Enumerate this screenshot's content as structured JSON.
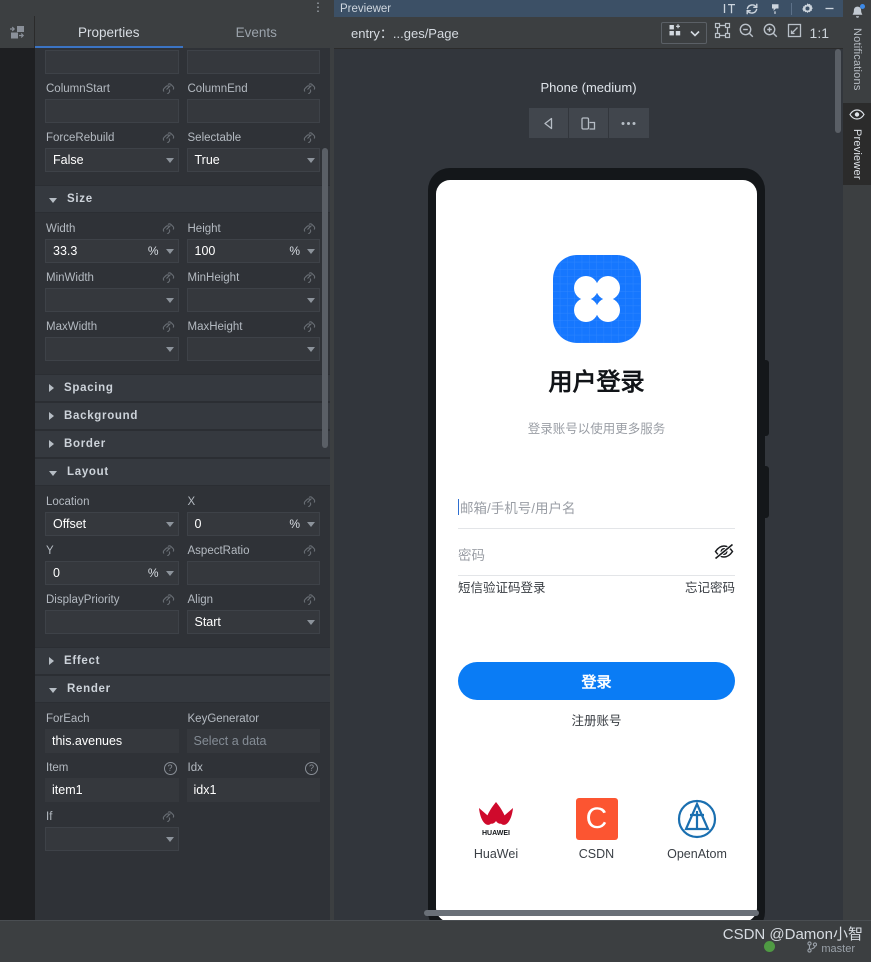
{
  "properties_panel": {
    "window_dots": "⋮",
    "panel_icon": "add-component-icon",
    "tabs": [
      {
        "label": "Properties",
        "active": true
      },
      {
        "label": "Events",
        "active": false
      }
    ],
    "sections": [
      {
        "name": "top-fields",
        "title": "",
        "expanded": true,
        "rows": [
          {
            "left": {
              "label": "",
              "value": "",
              "type": "text",
              "link": false
            },
            "right": {
              "label": "",
              "value": "",
              "type": "text",
              "link": false
            }
          },
          {
            "left": {
              "label": "ColumnStart",
              "value": "",
              "type": "text",
              "link": true
            },
            "right": {
              "label": "ColumnEnd",
              "value": "",
              "type": "text",
              "link": true
            }
          },
          {
            "left": {
              "label": "ForceRebuild",
              "value": "False",
              "type": "select",
              "link": true
            },
            "right": {
              "label": "Selectable",
              "value": "True",
              "type": "select",
              "link": true
            }
          }
        ]
      },
      {
        "name": "size",
        "title": "Size",
        "expanded": true,
        "rows": [
          {
            "left": {
              "label": "Width",
              "value": "33.3",
              "unit": "%",
              "type": "unit-select",
              "link": true
            },
            "right": {
              "label": "Height",
              "value": "100",
              "unit": "%",
              "type": "unit-select",
              "link": true
            }
          },
          {
            "left": {
              "label": "MinWidth",
              "value": "",
              "type": "select",
              "link": true
            },
            "right": {
              "label": "MinHeight",
              "value": "",
              "type": "select",
              "link": true
            }
          },
          {
            "left": {
              "label": "MaxWidth",
              "value": "",
              "type": "select",
              "link": true
            },
            "right": {
              "label": "MaxHeight",
              "value": "",
              "type": "select",
              "link": true
            }
          }
        ]
      },
      {
        "name": "spacing",
        "title": "Spacing",
        "expanded": false,
        "rows": []
      },
      {
        "name": "background",
        "title": "Background",
        "expanded": false,
        "rows": []
      },
      {
        "name": "border",
        "title": "Border",
        "expanded": false,
        "rows": []
      },
      {
        "name": "layout",
        "title": "Layout",
        "expanded": true,
        "rows": [
          {
            "left": {
              "label": "Location",
              "value": "Offset",
              "type": "select",
              "link": false
            },
            "right": {
              "label": "X",
              "value": "0",
              "unit": "%",
              "type": "unit-select",
              "link": true
            }
          },
          {
            "left": {
              "label": "Y",
              "value": "0",
              "unit": "%",
              "type": "unit-select",
              "link": true
            },
            "right": {
              "label": "AspectRatio",
              "value": "",
              "type": "text",
              "link": true
            }
          },
          {
            "left": {
              "label": "DisplayPriority",
              "value": "",
              "type": "text",
              "link": true
            },
            "right": {
              "label": "Align",
              "value": "Start",
              "type": "select",
              "link": true
            }
          }
        ]
      },
      {
        "name": "effect",
        "title": "Effect",
        "expanded": false,
        "rows": []
      },
      {
        "name": "render",
        "title": "Render",
        "expanded": true,
        "rows": [
          {
            "left": {
              "label": "ForEach",
              "value": "this.avenues",
              "type": "plain",
              "link": false
            },
            "right": {
              "label": "KeyGenerator",
              "value": "",
              "placeholder": "Select a data",
              "type": "plain",
              "link": false
            }
          },
          {
            "left": {
              "label": "Item",
              "value": "item1",
              "type": "plain",
              "help": true
            },
            "right": {
              "label": "Idx",
              "value": "idx1",
              "type": "plain",
              "help": true
            }
          },
          {
            "left": {
              "label": "If",
              "value": "",
              "type": "select",
              "link": true
            },
            "right": null
          }
        ]
      }
    ]
  },
  "previewer": {
    "window_title": "Previewer",
    "titlebar_icons": [
      "text-size-icon",
      "refresh-icon",
      "color-picker-icon",
      "settings-gear-icon",
      "minimize-icon"
    ],
    "path": "entry：...ges/Page",
    "toolbar_icons": [
      "grid-layout-icon",
      "chevron-down-icon",
      "select-frame-icon",
      "zoom-out-icon",
      "zoom-in-icon",
      "fit-screen-icon"
    ],
    "zoom_level": "1:1",
    "device_label": "Phone (medium)",
    "device_buttons": [
      "back-icon",
      "rotate-device-icon",
      "more-options-icon"
    ]
  },
  "login_screen": {
    "logo_name": "app-logo-grid-icon",
    "title": "用户登录",
    "subtitle": "登录账号以使用更多服务",
    "username": {
      "value": "",
      "placeholder": "邮箱/手机号/用户名"
    },
    "password": {
      "value": "",
      "placeholder": "密码",
      "toggle_icon": "eye-off-icon"
    },
    "sms_login_link": "短信验证码登录",
    "forgot_password_link": "忘记密码",
    "login_button": "登录",
    "register_link": "注册账号",
    "brand_color": "#0a7cf5",
    "brands": [
      {
        "label": "HuaWei",
        "icon": "huawei-logo-icon",
        "color": "#cf0a2c"
      },
      {
        "label": "CSDN",
        "icon": "csdn-logo-icon",
        "color": "#fc5531"
      },
      {
        "label": "OpenAtom",
        "icon": "openatom-logo-icon",
        "color": "#1a6fb0"
      }
    ]
  },
  "right_strip": {
    "items": [
      {
        "label": "Notifications",
        "icon": "bell-icon",
        "active": false,
        "has_badge": true
      },
      {
        "label": "Previewer",
        "icon": "eye-icon",
        "active": true,
        "has_badge": false
      }
    ]
  },
  "status_bar": {
    "watermark": "CSDN @Damon小智",
    "branch": "master",
    "branch_icon": "git-branch-icon"
  }
}
